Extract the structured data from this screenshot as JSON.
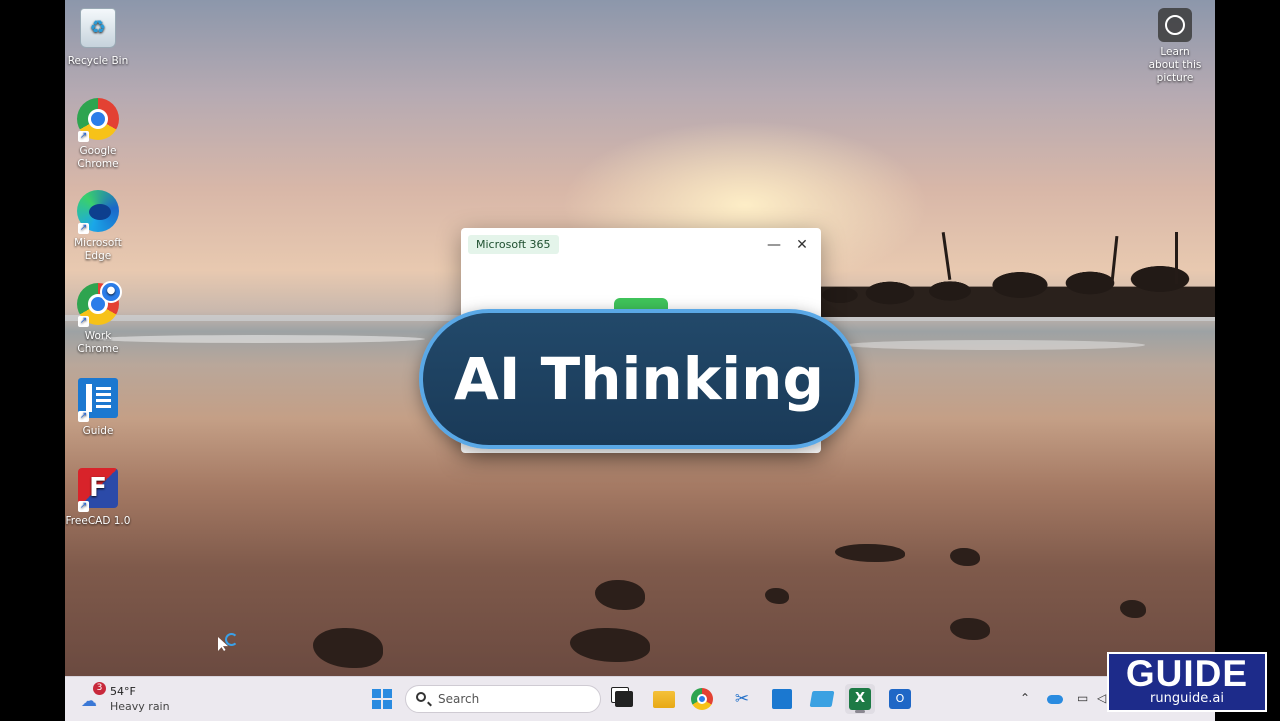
{
  "desktop": {
    "icons": [
      {
        "label": "Recycle Bin"
      },
      {
        "label": "Google Chrome"
      },
      {
        "label": "Microsoft Edge"
      },
      {
        "label": "Work Chrome"
      },
      {
        "label": "Guide"
      },
      {
        "label": "FreeCAD 1.0"
      }
    ],
    "learn_about": "Learn about this picture"
  },
  "m365_window": {
    "title": "Microsoft 365",
    "minimize": "—",
    "close": "✕"
  },
  "overlay": {
    "text": "AI Thinking"
  },
  "taskbar": {
    "weather": {
      "badge": "3",
      "temp": "54°F",
      "condition": "Heavy rain"
    },
    "search_placeholder": "Search"
  },
  "brand_badge": {
    "title": "GUIDE",
    "url": "runguide.ai"
  },
  "colors": {
    "accent": "#2a8be0",
    "pill_border": "#5aa8e6",
    "pill_bg": "#1f4465",
    "badge_bg": "#1d2b8a"
  }
}
